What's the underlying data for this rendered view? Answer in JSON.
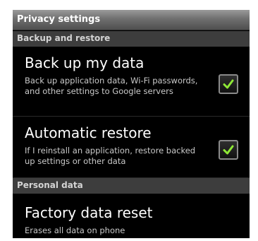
{
  "title": "Privacy settings",
  "sections": {
    "backup": {
      "header": "Backup and restore",
      "items": [
        {
          "title": "Back up my data",
          "summary": "Back up application data, Wi-Fi passwords, and other settings to Google servers",
          "checked": true
        },
        {
          "title": "Automatic restore",
          "summary": "If I reinstall an application, restore backed up settings or other data",
          "checked": true
        }
      ]
    },
    "personal": {
      "header": "Personal data",
      "items": [
        {
          "title": "Factory data reset",
          "summary": "Erases all data on phone"
        }
      ]
    }
  },
  "colors": {
    "checkmark": "#8ee836",
    "background": "#000000",
    "section_header": "#3d3d3d"
  },
  "icons": {
    "checkbox": "check-icon"
  }
}
